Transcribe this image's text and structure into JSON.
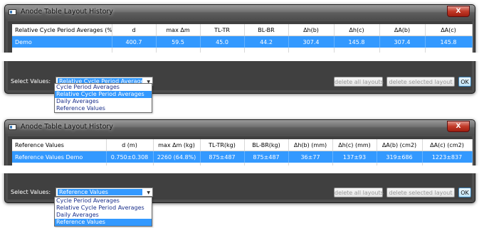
{
  "window1": {
    "title": "Anode Table Layout History",
    "close": "X",
    "headers": [
      "Relative Cycle Period Averages (%)",
      "d",
      "max Δm",
      "TL-TR",
      "BL-BR",
      "Δh(b)",
      "Δh(c)",
      "ΔA(b)",
      "ΔA(c)"
    ],
    "row": [
      "Demo",
      "400.7",
      "59.5",
      "45.0",
      "44.2",
      "307.4",
      "145.8",
      "307.4",
      "145.8"
    ],
    "select_label": "Select Values:",
    "select_value": "Relative Cycle Period Averages",
    "delete_all": "delete all layouts",
    "delete_selected": "delete selected layout",
    "ok": "OK",
    "options": [
      "Cycle Period Averages",
      "Relative Cycle Period Averages",
      "Daily Averages",
      "Reference Values"
    ]
  },
  "window2": {
    "title": "Anode Table Layout History",
    "close": "X",
    "headers": [
      "Reference Values",
      "d (m)",
      "max Δm (kg)",
      "TL-TR(kg)",
      "BL-BR(kg)",
      "Δh(b) (mm)",
      "Δh(c) (mm)",
      "ΔA(b) (cm2)",
      "ΔA(c) (cm2)"
    ],
    "row": [
      "Reference Values Demo",
      "0.750±0.308",
      "2260 (64.8%)",
      "875±487",
      "875±487",
      "36±77",
      "137±93",
      "319±686",
      "1223±837"
    ],
    "select_label": "Select Values:",
    "select_value": "Reference Values",
    "delete_all": "delete all layouts",
    "delete_selected": "delete selected layout",
    "ok": "OK",
    "options": [
      "Cycle Period Averages",
      "Relative Cycle Period Averages",
      "Daily Averages",
      "Reference Values"
    ]
  },
  "colors": {
    "selection": "#3399ff",
    "window_bg": "#4e4e4e",
    "close_red": "#c23a28"
  },
  "icons": {
    "app": "window-app-icon",
    "close": "close-icon",
    "dropdown": "chevron-down-icon"
  }
}
